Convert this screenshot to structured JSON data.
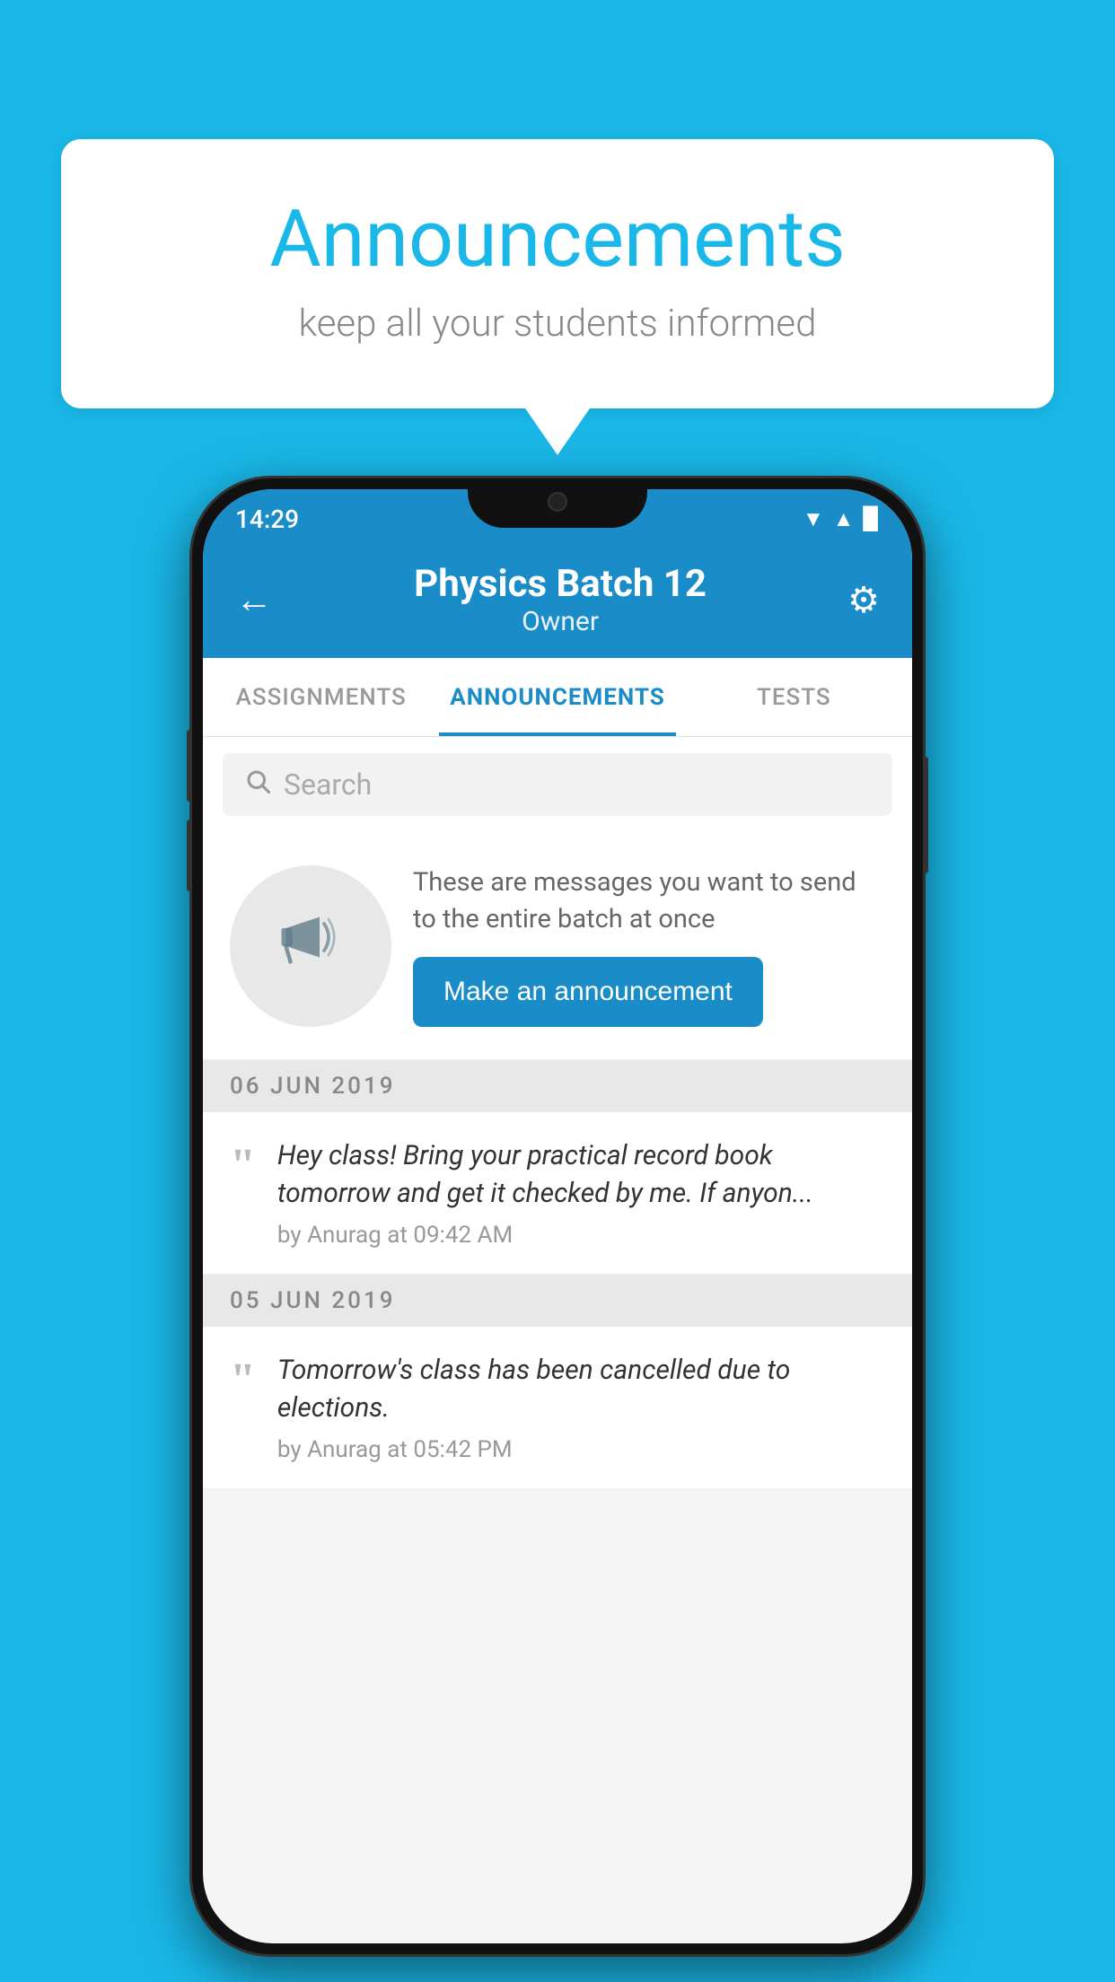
{
  "speech_bubble": {
    "title": "Announcements",
    "subtitle": "keep all your students informed"
  },
  "status_bar": {
    "time": "14:29",
    "wifi": "▲",
    "signal": "▲",
    "battery": "▉"
  },
  "header": {
    "title": "Physics Batch 12",
    "subtitle": "Owner",
    "back_label": "←",
    "gear_label": "⚙"
  },
  "tabs": [
    {
      "label": "ASSIGNMENTS",
      "active": false
    },
    {
      "label": "ANNOUNCEMENTS",
      "active": true
    },
    {
      "label": "TESTS",
      "active": false
    }
  ],
  "search": {
    "placeholder": "Search"
  },
  "promo": {
    "description": "These are messages you want to send to the entire batch at once",
    "button_label": "Make an announcement"
  },
  "announcements": [
    {
      "date": "06  JUN  2019",
      "text": "Hey class! Bring your practical record book tomorrow and get it checked by me. If anyon...",
      "meta": "by Anurag at 09:42 AM"
    },
    {
      "date": "05  JUN  2019",
      "text": "Tomorrow's class has been cancelled due to elections.",
      "meta": "by Anurag at 05:42 PM"
    }
  ]
}
